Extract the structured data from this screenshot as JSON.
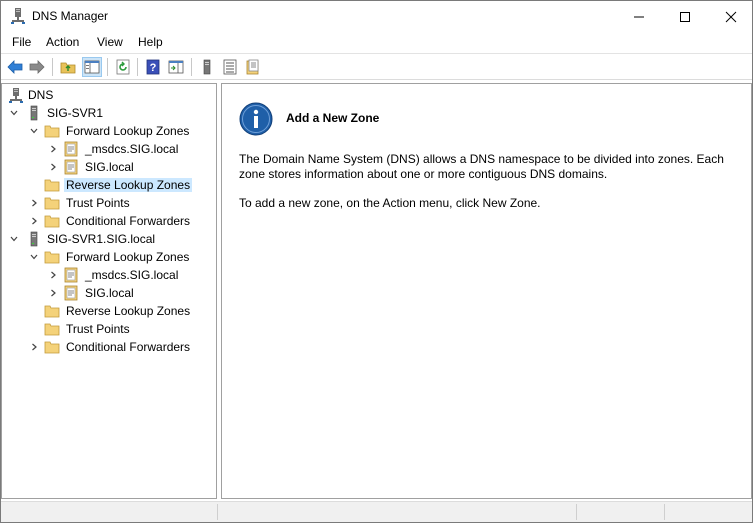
{
  "window": {
    "title": "DNS Manager"
  },
  "menu": {
    "file": "File",
    "action": "Action",
    "view": "View",
    "help": "Help"
  },
  "tree": {
    "root": "DNS",
    "server1": {
      "name": "SIG-SVR1",
      "forward": "Forward Lookup Zones",
      "zone_msdcs": "_msdcs.SIG.local",
      "zone_sig": "SIG.local",
      "reverse": "Reverse Lookup Zones",
      "trust": "Trust Points",
      "conditional": "Conditional Forwarders"
    },
    "server2": {
      "name": "SIG-SVR1.SIG.local",
      "forward": "Forward Lookup Zones",
      "zone_msdcs": "_msdcs.SIG.local",
      "zone_sig": "SIG.local",
      "reverse": "Reverse Lookup Zones",
      "trust": "Trust Points",
      "conditional": "Conditional Forwarders"
    }
  },
  "content": {
    "title": "Add a New Zone",
    "description": "The Domain Name System (DNS) allows a DNS namespace to be divided into zones. Each zone stores information about one or more contiguous DNS domains.",
    "hint": "To add a new zone, on the Action menu, click New Zone."
  },
  "colors": {
    "selection": "#cce8ff",
    "info_blue": "#1f5fa8",
    "folder": "#f4d27a"
  },
  "icons": {
    "back": "back-arrow-icon",
    "forward": "forward-arrow-icon",
    "up": "up-folder-icon",
    "console_tree": "show-hide-tree-icon",
    "refresh": "refresh-icon",
    "help": "help-icon",
    "action_pane": "action-pane-icon"
  }
}
